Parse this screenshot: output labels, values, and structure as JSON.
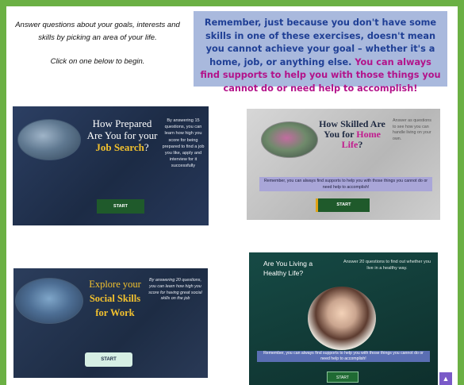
{
  "intro": {
    "line1": "Answer questions about your goals, interests and skills by picking an area of your life.",
    "line2": "Click on one below to begin."
  },
  "notice": {
    "part1": "Remember, just because you don't have some skills in one of these exercises, doesn't mean you cannot achieve your goal – whether it's a home, job, or anything else.",
    "part2": "You can always find supports to help you with those things you cannot do or need help to accomplish!"
  },
  "cards": [
    {
      "title_a": "How Prepared Are You for your ",
      "title_hl": "Job Search",
      "title_end": "?",
      "desc": "By answering 15 questions, you can learn how high you score for being prepared to find a job you like, apply and interview for it successfully",
      "button": "START"
    },
    {
      "title_a": "How Skilled Are You for ",
      "title_hl": "Home Life",
      "title_end": "?",
      "desc": "Answer as questions to see how you can handle living on your own.",
      "bar": "Remember, you can always find supports to help you with those things you cannot do or need help to accomplish!",
      "button": "START"
    },
    {
      "title_a": "Explore your ",
      "title_hl": "Social Skills for Work",
      "desc": "By answering 20 questions, you can learn how high you score for having great social skills on the job",
      "button": "START"
    },
    {
      "title": "Are You Living a Healthy Life?",
      "desc": "Answer 20 questions to find out whether you live in a healthy way.",
      "bar": "Remember, you can always find supports to help you with those things you cannot do or need help to accomplish!",
      "button": "START"
    }
  ],
  "scroll_top_icon": "▲",
  "colors": {
    "frame": "#6bb044",
    "notice_bg": "#a9b9dd",
    "notice_blue": "#1f3f95",
    "notice_pink": "#b3128a",
    "gold": "#f2c12e",
    "green_btn": "#1f5a2b"
  }
}
